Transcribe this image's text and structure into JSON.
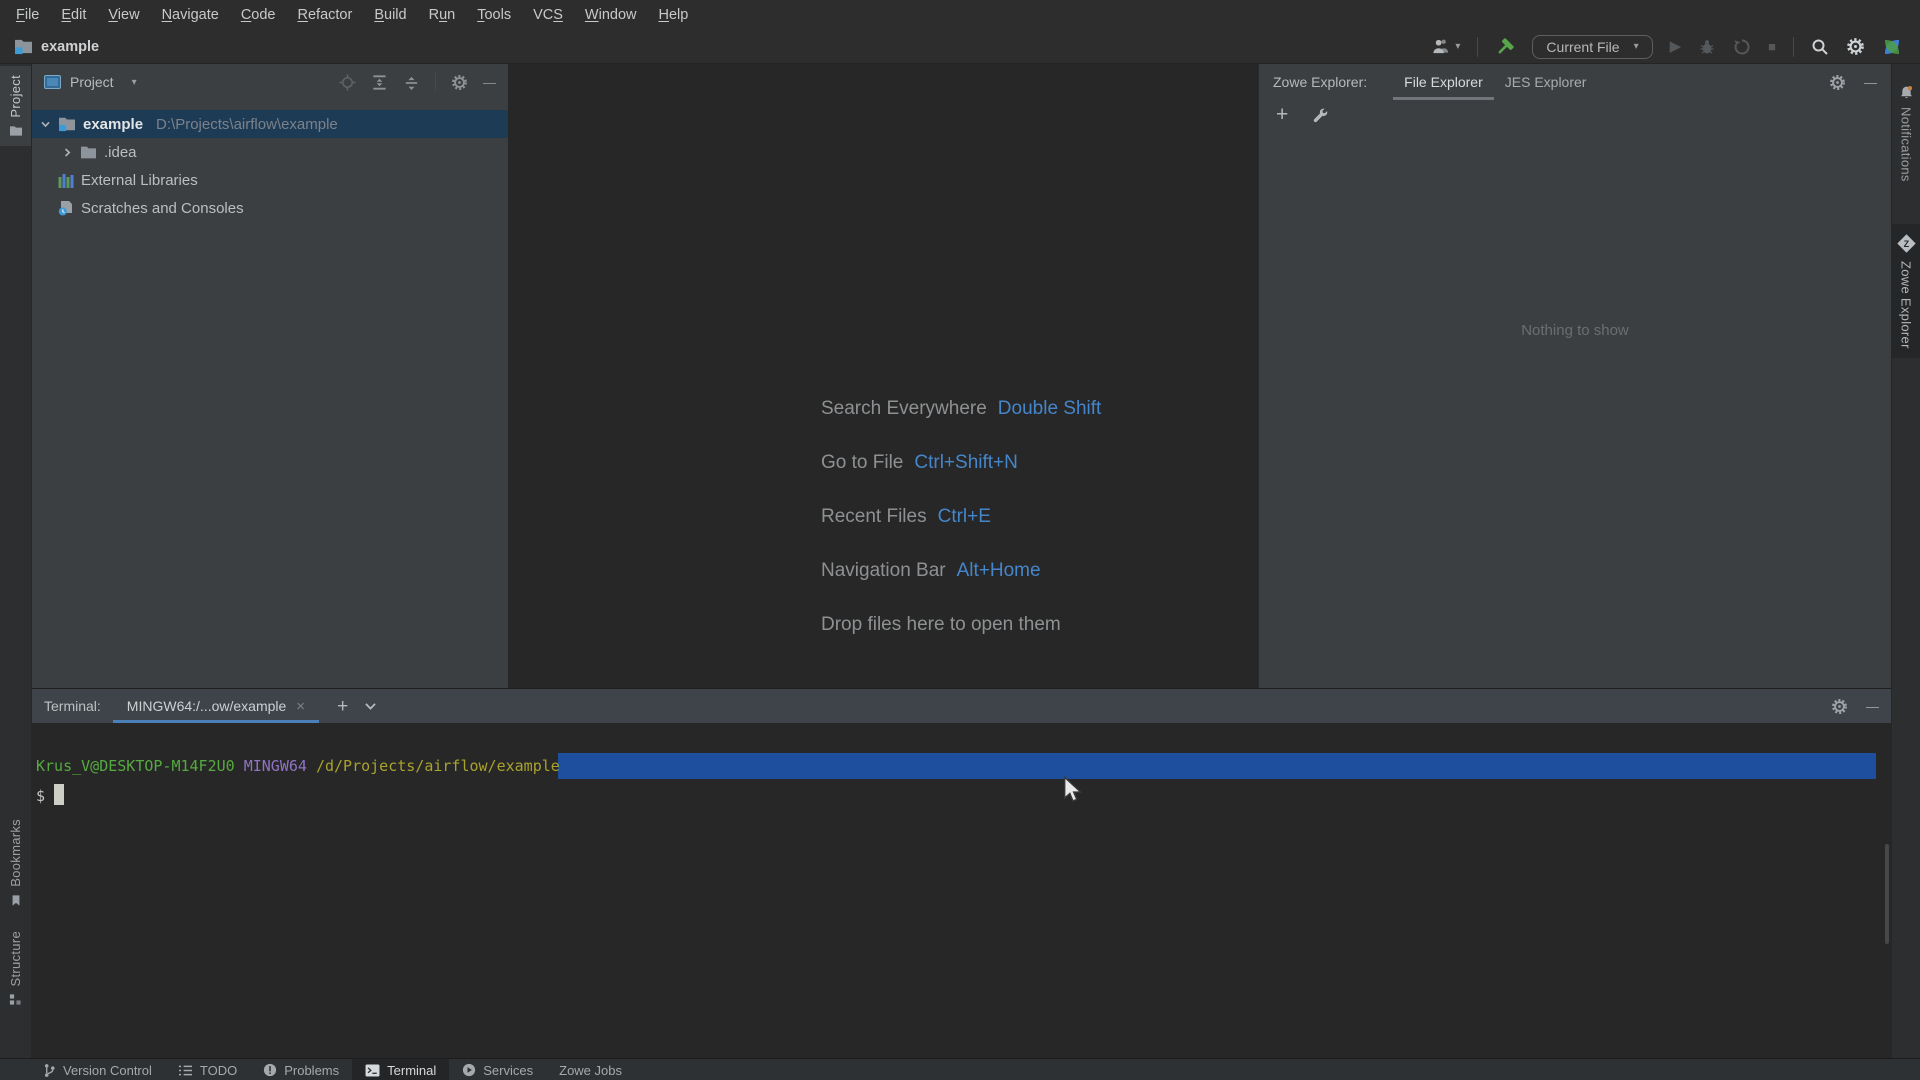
{
  "menu": {
    "items": [
      {
        "label": "File",
        "mnemonic": 0
      },
      {
        "label": "Edit",
        "mnemonic": 0
      },
      {
        "label": "View",
        "mnemonic": 0
      },
      {
        "label": "Navigate",
        "mnemonic": 0
      },
      {
        "label": "Code",
        "mnemonic": 0
      },
      {
        "label": "Refactor",
        "mnemonic": 0
      },
      {
        "label": "Build",
        "mnemonic": 0
      },
      {
        "label": "Run",
        "mnemonic": 1
      },
      {
        "label": "Tools",
        "mnemonic": 0
      },
      {
        "label": "VCS",
        "mnemonic": 2
      },
      {
        "label": "Window",
        "mnemonic": 0
      },
      {
        "label": "Help",
        "mnemonic": 0
      }
    ]
  },
  "titlebar": {
    "project": "example"
  },
  "toolbar": {
    "run_config": "Current File"
  },
  "left_strip": {
    "project": "Project",
    "bookmarks": "Bookmarks",
    "structure": "Structure"
  },
  "right_strip": {
    "notifications": "Notifications",
    "zowe": "Zowe Explorer"
  },
  "project_panel": {
    "title": "Project",
    "tree": {
      "root_name": "example",
      "root_path": "D:\\Projects\\airflow\\example",
      "items": [
        ".idea",
        "External Libraries",
        "Scratches and Consoles"
      ]
    }
  },
  "editor": {
    "shortcuts": [
      {
        "label": "Search Everywhere",
        "keys": "Double Shift"
      },
      {
        "label": "Go to File",
        "keys": "Ctrl+Shift+N"
      },
      {
        "label": "Recent Files",
        "keys": "Ctrl+E"
      },
      {
        "label": "Navigation Bar",
        "keys": "Alt+Home"
      },
      {
        "label": "Drop files here to open them",
        "keys": ""
      }
    ]
  },
  "zowe_panel": {
    "title": "Zowe Explorer:",
    "tabs": [
      "File Explorer",
      "JES Explorer"
    ],
    "active_tab": "File Explorer",
    "empty_text": "Nothing to show"
  },
  "terminal": {
    "label": "Terminal:",
    "tab": "MINGW64:/...ow/example",
    "prompt_user": "Krus_V@DESKTOP-M14F2U0",
    "prompt_env": "MINGW64",
    "prompt_path": "/d/Projects/airflow/example",
    "prompt_symbol": "$"
  },
  "statusbar": {
    "items": [
      "Version Control",
      "TODO",
      "Problems",
      "Terminal",
      "Services",
      "Zowe Jobs"
    ],
    "active": "Terminal"
  },
  "glyphs": {
    "close": "×",
    "minimize": "—",
    "add": "+",
    "caret_down": "▾",
    "play": "▶",
    "stop": "■"
  },
  "colors": {
    "panel_bg": "#3c3f42",
    "editor_bg": "#272727",
    "top_bg": "#2d2d2d",
    "tree_selection": "#1d3b55",
    "terminal_selection": "#1d4f9e",
    "shortcut_key_blue": "#4586cb",
    "terminal_tab_underline": "#4a7fb8",
    "terminal_green": "#55ab3f",
    "terminal_purple": "#9173c4",
    "terminal_yellow": "#a9a22d",
    "hammer_green": "#57a64a"
  }
}
